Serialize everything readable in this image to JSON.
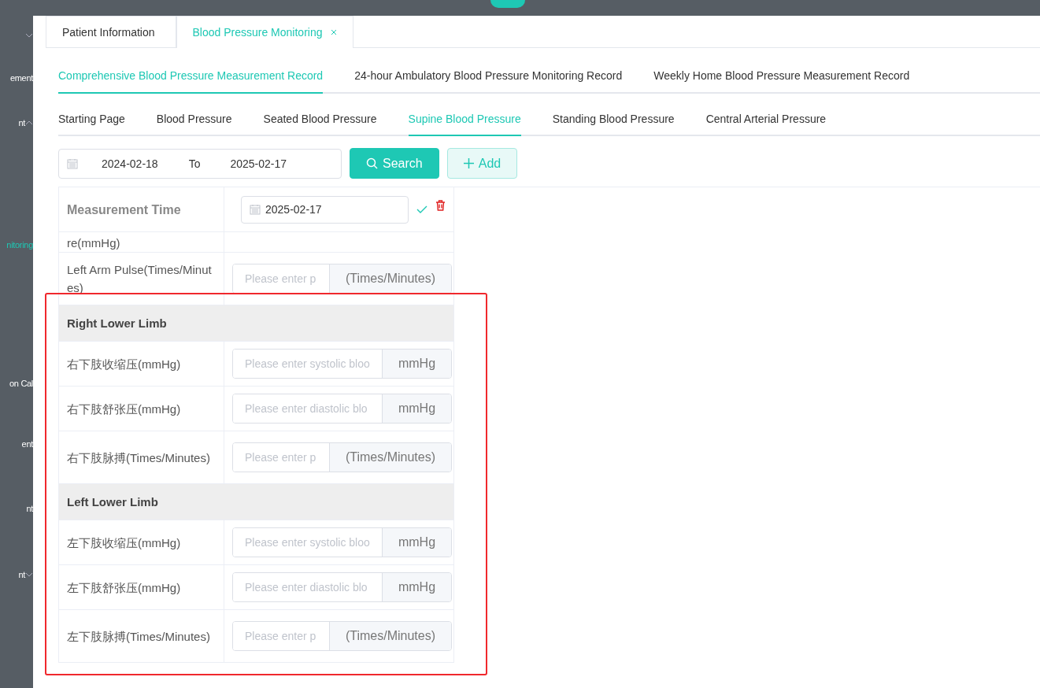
{
  "sidebar": {
    "items": [
      {
        "kind": "group",
        "expanded": false
      },
      {
        "kind": "link",
        "label": "ement",
        "selected": false
      },
      {
        "kind": "group",
        "label": "nt",
        "expanded": true,
        "selected": false
      },
      {
        "kind": "link",
        "label": "nitoring",
        "selected": true
      },
      {
        "kind": "link",
        "label": "on Cal",
        "selected": false
      },
      {
        "kind": "link",
        "label": "ent",
        "selected": false
      },
      {
        "kind": "link",
        "label": "nt",
        "selected": false
      },
      {
        "kind": "group",
        "label": "nt",
        "expanded": false,
        "selected": false
      }
    ]
  },
  "page_tabs": [
    {
      "label": "Patient Information",
      "selected": false,
      "closable": false
    },
    {
      "label": "Blood Pressure Monitoring",
      "selected": true,
      "closable": true
    }
  ],
  "record_tabs": [
    {
      "label": "Comprehensive Blood Pressure Measurement Record",
      "selected": true
    },
    {
      "label": "24-hour Ambulatory Blood Pressure Monitoring Record",
      "selected": false
    },
    {
      "label": "Weekly Home Blood Pressure Measurement Record",
      "selected": false
    }
  ],
  "sub_tabs": [
    {
      "label": "Starting Page",
      "selected": false
    },
    {
      "label": "Blood Pressure",
      "selected": false
    },
    {
      "label": "Seated Blood Pressure",
      "selected": false
    },
    {
      "label": "Supine Blood Pressure",
      "selected": true
    },
    {
      "label": "Standing Blood Pressure",
      "selected": false
    },
    {
      "label": "Central Arterial Pressure",
      "selected": false
    }
  ],
  "filter": {
    "start": "2024-02-18",
    "separator": "To",
    "end": "2025-02-17",
    "search_button": "Search",
    "add_button": "Add"
  },
  "table": {
    "header": {
      "label": "Measurement Time",
      "date": "2025-02-17"
    },
    "rows": [
      {
        "kind": "partial",
        "label": "re(mmHg)"
      },
      {
        "kind": "field",
        "label": "Left Arm Pulse(Times/Minutes)",
        "placeholder": "Please enter p",
        "unit": "(Times/Minutes)",
        "wide_unit": true
      },
      {
        "kind": "section",
        "label": "Right Lower Limb"
      },
      {
        "kind": "field",
        "label": "右下肢收缩压(mmHg)",
        "placeholder": "Please enter systolic bloo",
        "unit": "mmHg",
        "wide_unit": false
      },
      {
        "kind": "field",
        "label": "右下肢舒张压(mmHg)",
        "placeholder": "Please enter diastolic blo",
        "unit": "mmHg",
        "wide_unit": false
      },
      {
        "kind": "field",
        "label": "右下肢脉搏(Times/Minutes)",
        "placeholder": "Please enter p",
        "unit": "(Times/Minutes)",
        "wide_unit": true
      },
      {
        "kind": "section",
        "label": "Left Lower Limb"
      },
      {
        "kind": "field",
        "label": "左下肢收缩压(mmHg)",
        "placeholder": "Please enter systolic bloo",
        "unit": "mmHg",
        "wide_unit": false
      },
      {
        "kind": "field",
        "label": "左下肢舒张压(mmHg)",
        "placeholder": "Please enter diastolic blo",
        "unit": "mmHg",
        "wide_unit": false
      },
      {
        "kind": "field",
        "label": "左下肢脉搏(Times/Minutes)",
        "placeholder": "Please enter p",
        "unit": "(Times/Minutes)",
        "wide_unit": true
      }
    ]
  }
}
